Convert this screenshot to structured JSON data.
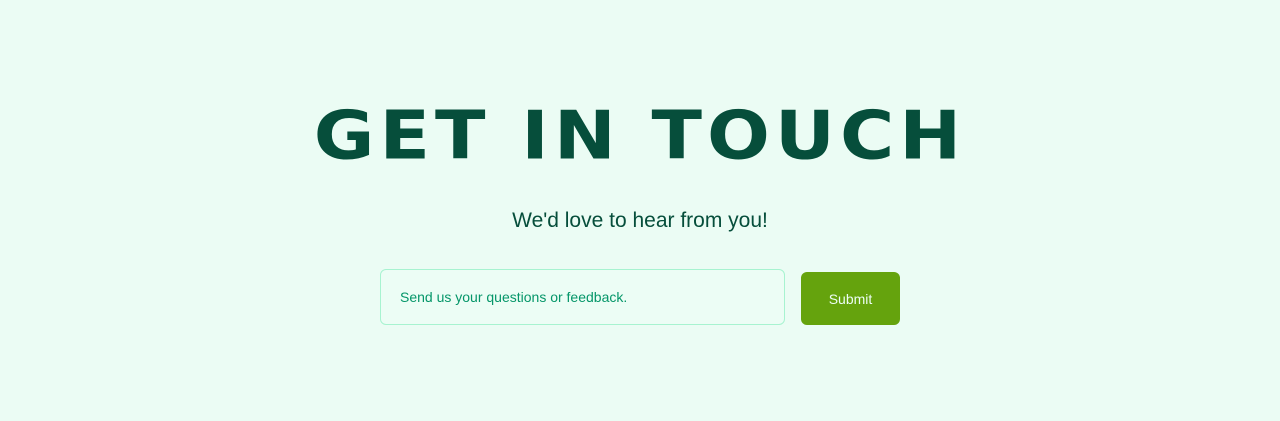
{
  "contact": {
    "title": "Get in touch",
    "subtitle": "We'd love to hear from you!",
    "message_placeholder": "Send us your questions or feedback.",
    "message_value": "",
    "submit_label": "Submit"
  },
  "colors": {
    "background": "#ebfcf4",
    "heading": "#064e3b",
    "input_border": "#a7f3d0",
    "input_text": "#059669",
    "button": "#65a30d",
    "button_text": "#ecfdf5"
  }
}
